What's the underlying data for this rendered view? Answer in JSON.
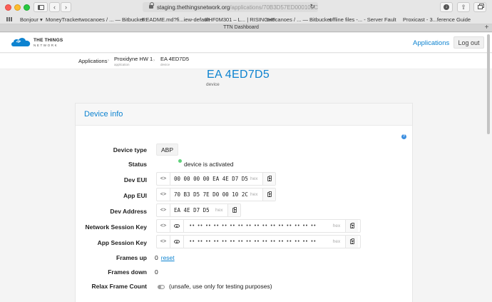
{
  "browser": {
    "url_main": "staging.thethingsnetwork.org",
    "url_path": "/applications/70B3D57ED000102C/de",
    "tab_title": "TTN Dashboard",
    "bookmarks": [
      {
        "label": "Bonjour",
        "has_dropdown": true
      },
      {
        "label": "MoneyTracker"
      },
      {
        "label": "twocanoes / ... — Bitbucket"
      },
      {
        "label": "README.md?fi...iew-default"
      },
      {
        "label": "RHF0M301 – L... | RISINGHF"
      },
      {
        "label": "twocanoes / ... — Bitbucket"
      },
      {
        "label": "offline files -... - Server Fault"
      },
      {
        "label": "Proxicast - 3...ference Guide"
      }
    ]
  },
  "header": {
    "logo_line1": "THE THINGS",
    "logo_line2": "NETWORK",
    "nav_applications": "Applications",
    "logout": "Log out",
    "brand_color": "#0d83d0"
  },
  "breadcrumb": {
    "root": "Applications",
    "app_name": "Proxidyne HW 1",
    "app_sub": "application",
    "device_name": "EA 4ED7D5",
    "device_sub": "device"
  },
  "device_header": {
    "title": "EA 4ED7D5",
    "subtitle": "device"
  },
  "device_info": {
    "title": "Device info",
    "help": "?",
    "device_type_label": "Device type",
    "device_type_value": "ABP",
    "status_label": "Status",
    "status_value": "device is activated",
    "status_color": "#5fd27b",
    "dev_eui_label": "Dev EUI",
    "dev_eui_value": "00 00 00 00 EA 4E D7 D5",
    "app_eui_label": "App EUI",
    "app_eui_value": "70 B3 D5 7E D0 00 10 2C",
    "dev_addr_label": "Dev Address",
    "dev_addr_value": "EA 4E D7 D5",
    "nwk_skey_label": "Network Session Key",
    "nwk_skey_value": "•• •• •• •• •• •• •• •• •• •• •• •• •• •• •• ••",
    "app_skey_label": "App Session Key",
    "app_skey_value": "•• •• •• •• •• •• •• •• •• •• •• •• •• •• •• ••",
    "hex": "hex",
    "toggle_code_glyph": "<>",
    "frames_up_label": "Frames up",
    "frames_up_value": "0",
    "reset_label": "reset",
    "frames_down_label": "Frames down",
    "frames_down_value": "0",
    "relax_label": "Relax Frame Count",
    "relax_value": "(unsafe, use only for testing purposes)"
  }
}
